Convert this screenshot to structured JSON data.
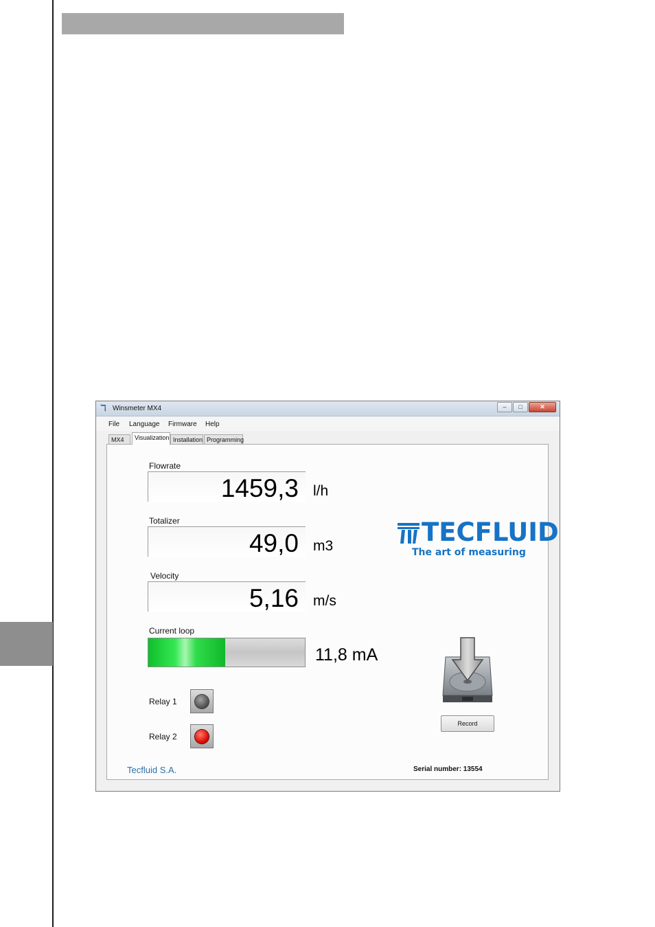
{
  "window": {
    "title": "Winsmeter MX4",
    "minimize_glyph": "–",
    "maximize_glyph": "□",
    "close_glyph": "✕"
  },
  "menu": [
    "File",
    "Language",
    "Firmware",
    "Help"
  ],
  "tabs": [
    {
      "label": "MX4",
      "active": false
    },
    {
      "label": "Visualization",
      "active": true
    },
    {
      "label": "Installation",
      "active": false
    },
    {
      "label": "Programming",
      "active": false
    }
  ],
  "flowrate": {
    "label": "Flowrate",
    "value": "1459,3",
    "unit": "l/h"
  },
  "totalizer": {
    "label": "Totalizer",
    "value": "49,0",
    "unit": "m3"
  },
  "velocity": {
    "label": "Velocity",
    "value": "5,16",
    "unit": "m/s"
  },
  "current_loop": {
    "label": "Current loop",
    "value": "11,8 mA",
    "fill_fraction": 0.49
  },
  "relays": [
    {
      "label": "Relay 1",
      "state": "off"
    },
    {
      "label": "Relay 2",
      "state": "on"
    }
  ],
  "logo": {
    "wordmark": "TECFLUID",
    "tagline": "The art of measuring",
    "color": "#1673c5"
  },
  "record_button": "Record",
  "footer": {
    "company": "Tecfluid S.A.",
    "serial": "Serial number: 13554"
  },
  "icons": {
    "app": "tecfluid-app-icon",
    "record": "disk-download-icon"
  }
}
